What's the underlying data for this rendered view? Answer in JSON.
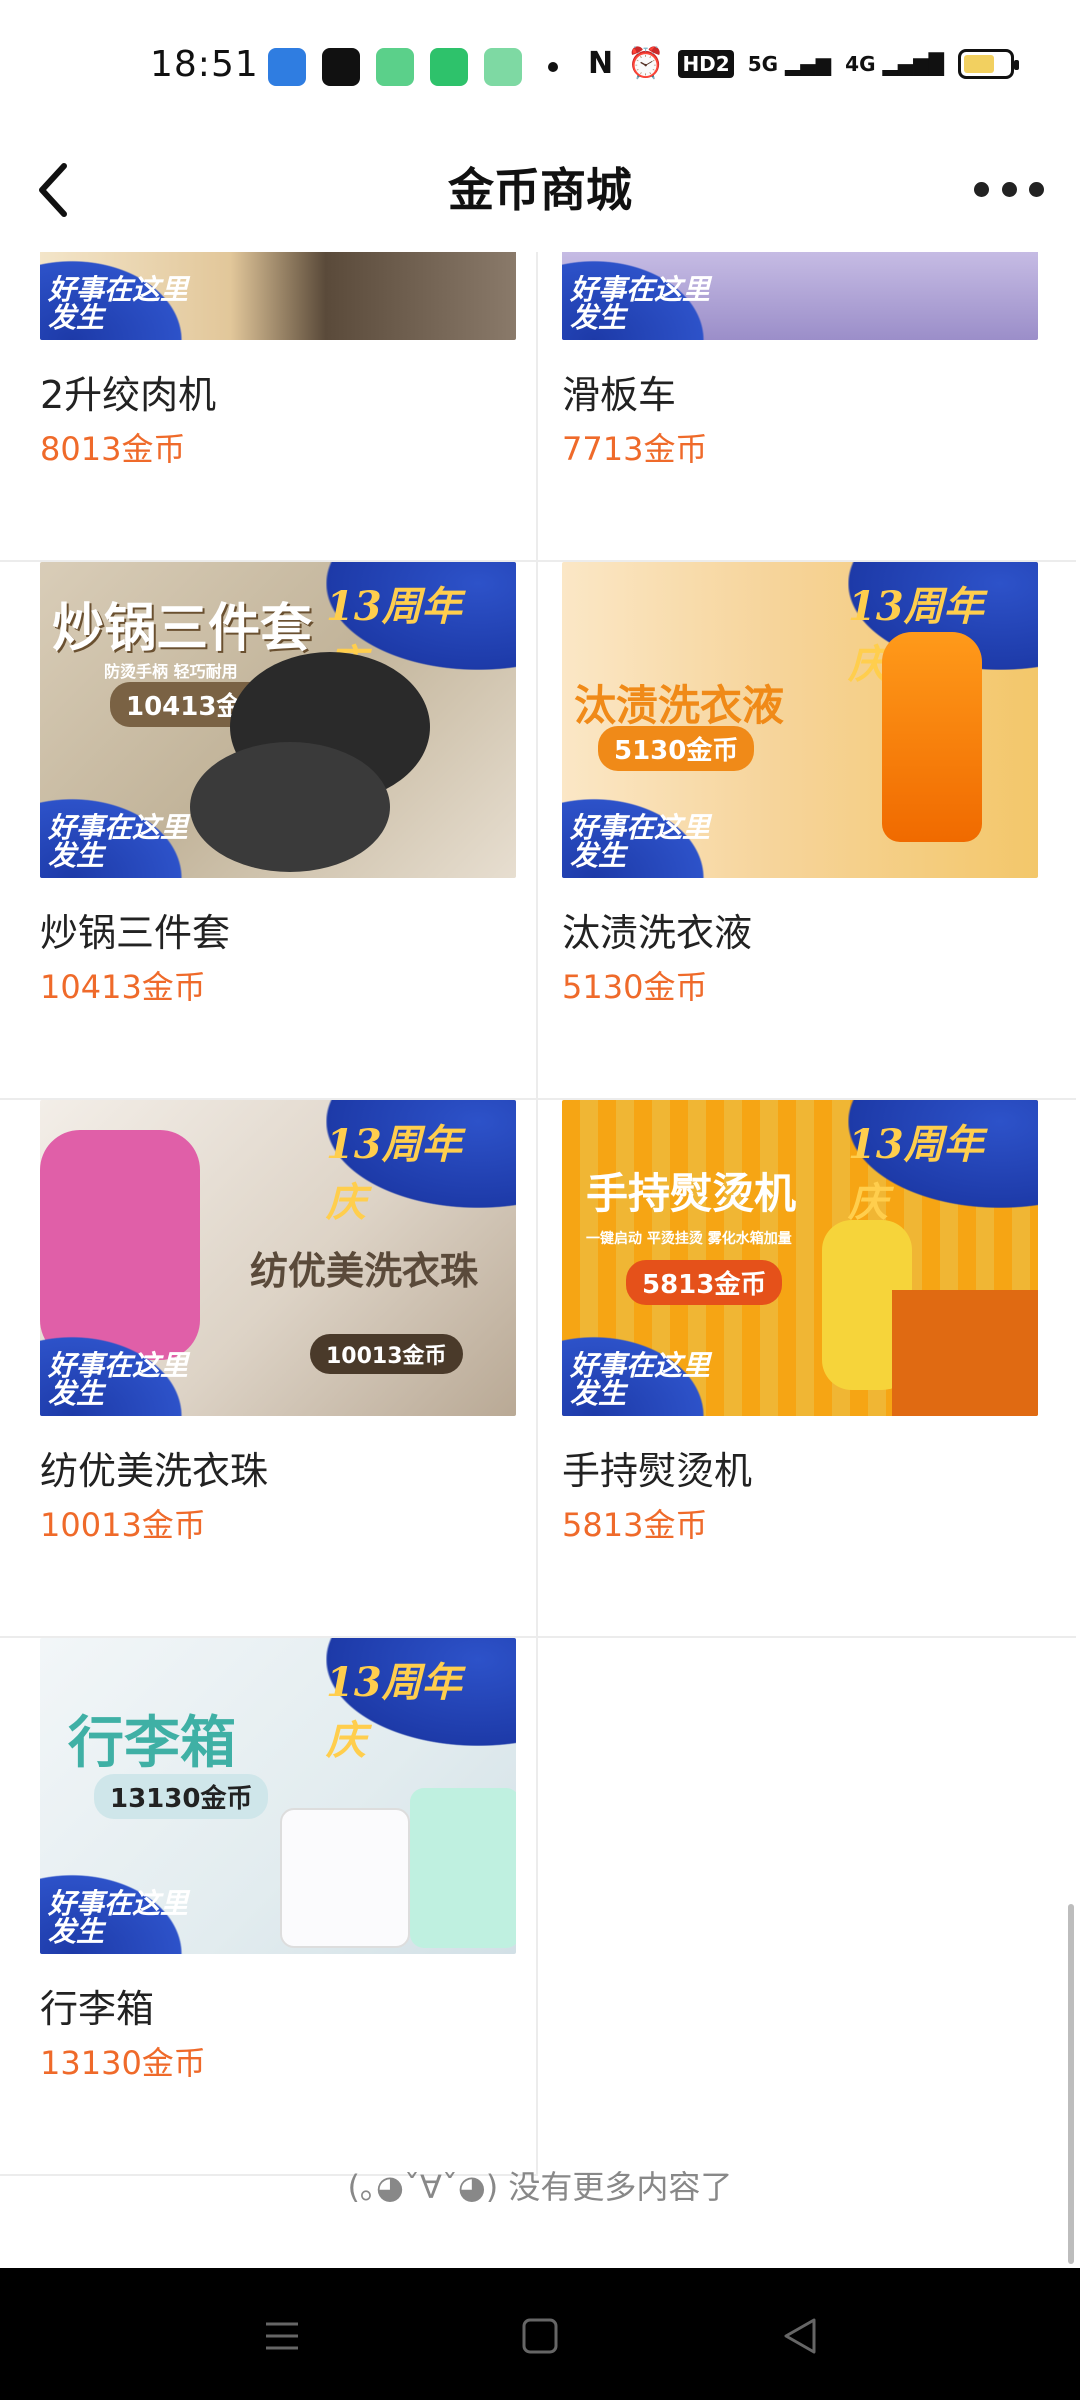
{
  "status": {
    "time": "18:51",
    "signal_5g": "5G",
    "signal_4g": "4G",
    "hd": "HD2"
  },
  "nav": {
    "title": "金币商城"
  },
  "products": [
    {
      "name": "2升绞肉机",
      "price": "8013金币"
    },
    {
      "name": "滑板车",
      "price": "7713金币"
    },
    {
      "name": "炒锅三件套",
      "price": "10413金币",
      "img_title": "炒锅三件套",
      "img_price": "10413金币",
      "img_sub": "防烫手柄     轻巧耐用"
    },
    {
      "name": "汰渍洗衣液",
      "price": "5130金币",
      "img_title": "汰渍洗衣液",
      "img_price": "5130金币"
    },
    {
      "name": "纺优美洗衣珠",
      "price": "10013金币",
      "img_title": "纺优美洗衣珠",
      "img_price": "10013金币"
    },
    {
      "name": "手持熨烫机",
      "price": "5813金币",
      "img_title": "手持熨烫机",
      "img_price": "5813金币",
      "img_sub": "一键启动   平烫挂烫   雾化水箱加量"
    },
    {
      "name": "行李箱",
      "price": "13130金币",
      "img_title": "行李箱",
      "img_price": "13130金币"
    }
  ],
  "img_badge": "13周年庆",
  "img_tag": "好事在这里发生",
  "footer": {
    "message": "(｡◕ˇ∀ˇ◕) 没有更多内容了"
  },
  "colors": {
    "price": "#ef6a2a",
    "divider": "#ececec"
  }
}
